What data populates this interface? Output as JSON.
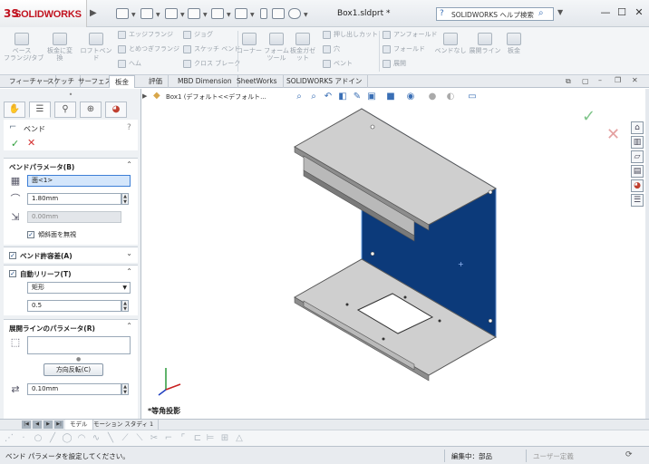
{
  "app": {
    "logo_text": "SOLIDWORKS",
    "logo_mark": "3S",
    "document_title": "Box1.sldprt *",
    "help_search_placeholder": "SOLIDWORKS ヘルプ検索",
    "window_min": "—",
    "window_max": "☐",
    "window_close": "✕"
  },
  "ribbon": {
    "big": [
      {
        "label": "ベース\nフランジ/タブ"
      },
      {
        "label": "板金に変\n換"
      },
      {
        "label": "ロフトベンド"
      }
    ],
    "small_col1": [
      "エッジフランジ",
      "とめつぎフランジ",
      "ヘム"
    ],
    "small_col2": [
      "ジョグ",
      "スケッチ ベンド",
      "クロス ブレーク"
    ],
    "big2": [
      {
        "label": "コーナー"
      },
      {
        "label": "フォーム\nツール"
      },
      {
        "label": "板金ガゼ\nット"
      }
    ],
    "small_col3": [
      "押し出しカット",
      "穴",
      "ベント"
    ],
    "small_col4": [
      "アンフォールド",
      "フォールド",
      "展開"
    ],
    "big3": [
      {
        "label": "ベンドなし"
      },
      {
        "label": "展開ライン"
      },
      {
        "label": "板金"
      }
    ]
  },
  "tabs": [
    "フィーチャー",
    "スケッチ",
    "サーフェス",
    "板金",
    "評価",
    "MBD Dimension",
    "SheetWorks",
    "SOLIDWORKS アドイン"
  ],
  "active_tab": "板金",
  "property_manager": {
    "title": "ベンド",
    "help": "?",
    "ok": "✓",
    "cancel": "✕",
    "tabs_icons": [
      "feature-tree",
      "property",
      "config",
      "dimxpert",
      "display"
    ],
    "bend_params": {
      "header": "ベンドパラメータ(B)",
      "face_value": "面<1>",
      "radius_value": "1.80mm",
      "thickness_value": "0.00mm",
      "ignore_bevel_label": "傾斜面を無視",
      "ignore_bevel_checked": true
    },
    "bend_allowance": {
      "header": "ベンド許容差(A)",
      "checked": true
    },
    "auto_relief": {
      "header": "自動リリーフ(T)",
      "checked": true,
      "type_value": "矩形",
      "ratio_value": "0.5"
    },
    "flat_line": {
      "header": "展開ラインのパラメータ(R)",
      "field_value": "",
      "reverse_button": "方向反転(C)",
      "offset_value": "0.10mm"
    }
  },
  "viewport": {
    "tree_label": "Box1  (デフォルト<<デフォルト...",
    "view_label": "*等角投影",
    "ok": "✓",
    "cancel": "✕",
    "colors": {
      "selected_face": "#0c3a7a",
      "part_gray": "#c8c8c8"
    }
  },
  "bottom_tabs": [
    "モデル",
    "モーション スタディ 1"
  ],
  "status": {
    "message": "ベンド パラメータを設定してください。",
    "mode": "編集中：部品",
    "units": "ユーザー定義"
  }
}
